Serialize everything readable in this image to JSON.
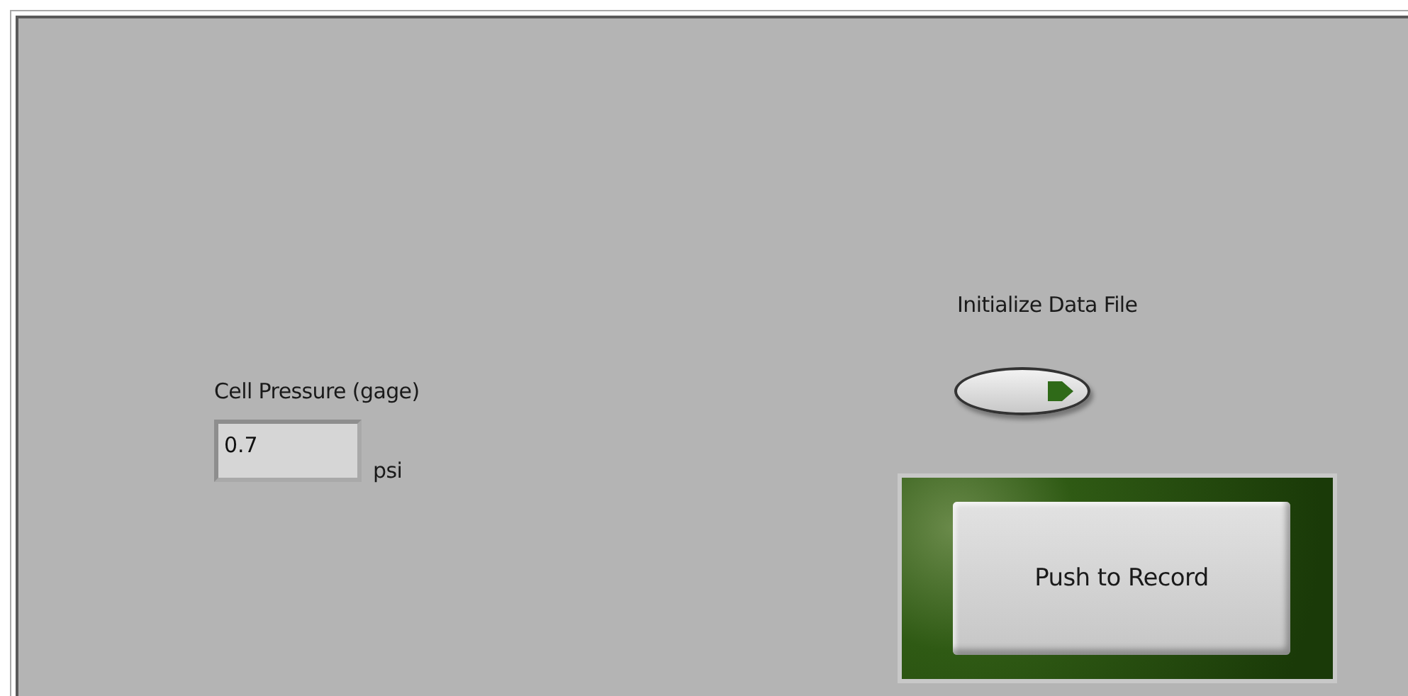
{
  "numeric": {
    "label": "Cell Pressure (gage)",
    "value": "0.7",
    "unit": "psi"
  },
  "toggle": {
    "label": "Initialize Data File",
    "on": false
  },
  "record_button": {
    "label": "Push to Record",
    "on": false
  }
}
